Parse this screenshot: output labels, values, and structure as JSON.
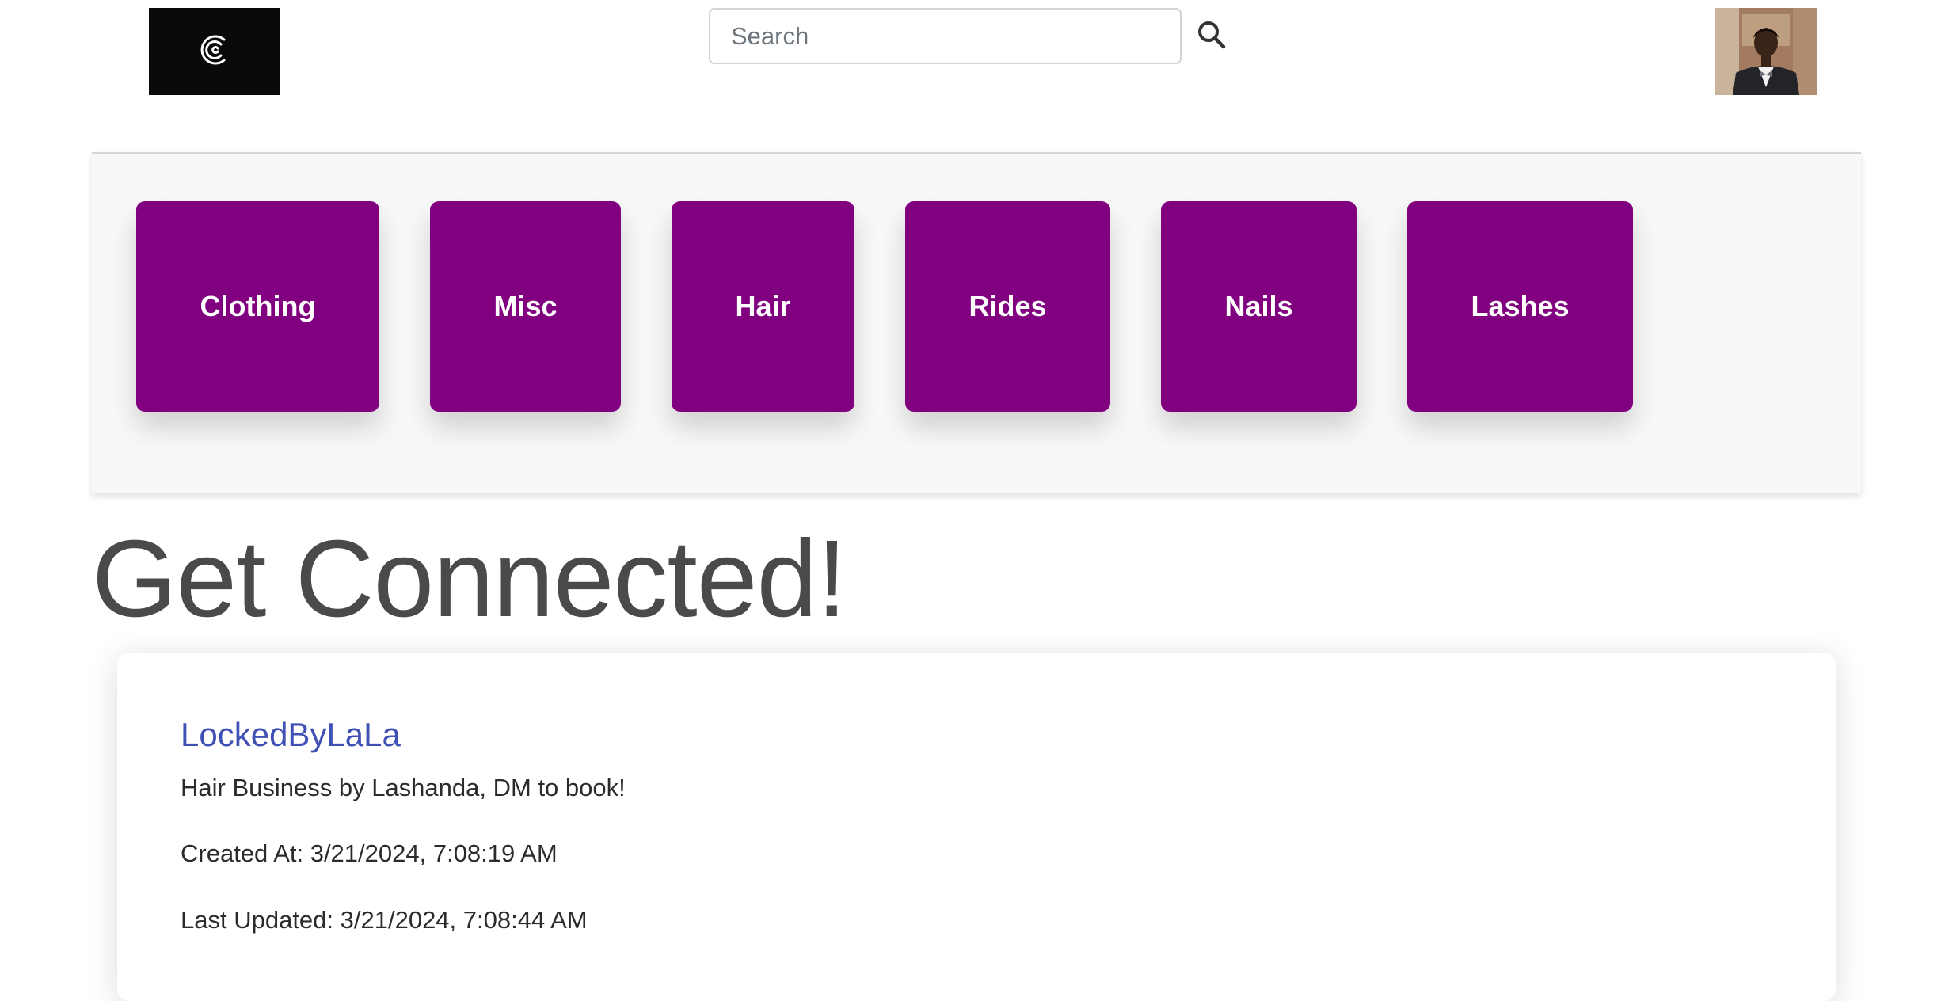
{
  "header": {
    "logo_icon": "c-logo-icon",
    "search": {
      "placeholder": "Search",
      "value": "",
      "icon": "search-icon"
    },
    "avatar_icon": "user-avatar-photo"
  },
  "categories": [
    {
      "label": "Clothing"
    },
    {
      "label": "Misc"
    },
    {
      "label": "Hair"
    },
    {
      "label": "Rides"
    },
    {
      "label": "Nails"
    },
    {
      "label": "Lashes"
    }
  ],
  "main": {
    "title": "Get Connected!"
  },
  "post": {
    "title": "LockedByLaLa",
    "description": "Hair Business by Lashanda, DM to book!",
    "created": "Created At: 3/21/2024, 7:08:19 AM",
    "updated": "Last Updated: 3/21/2024, 7:08:44 AM"
  },
  "colors": {
    "accent": "#800080",
    "link": "#3f51b5",
    "heading": "#4a4a4a",
    "logo_bg": "#0a0a0a"
  }
}
